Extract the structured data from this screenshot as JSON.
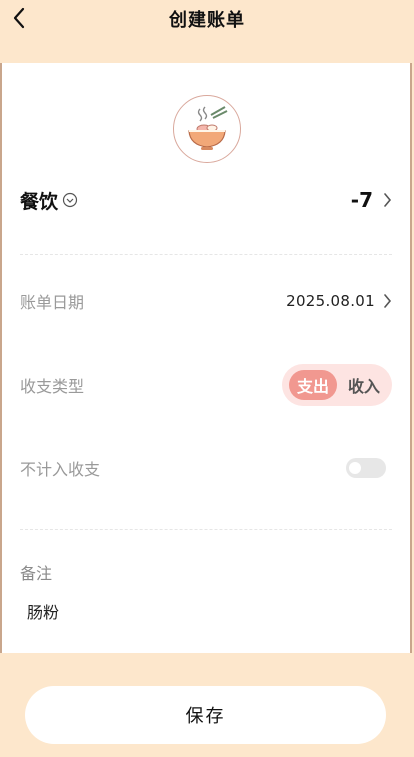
{
  "header": {
    "title": "创建账单",
    "back_icon": "chevron-left-icon"
  },
  "category": {
    "name": "餐饮",
    "icon": "noodle-bowl-icon",
    "dropdown_icon": "chevron-down-circle-icon",
    "amount": "-7"
  },
  "fields": {
    "date": {
      "label": "账单日期",
      "value": "2025.08.01"
    },
    "type": {
      "label": "收支类型",
      "options": [
        "支出",
        "收入"
      ],
      "selected": "支出"
    },
    "exclude": {
      "label": "不计入收支",
      "enabled": false
    }
  },
  "note": {
    "label": "备注",
    "value": "肠粉"
  },
  "footer": {
    "save_label": "保存"
  },
  "colors": {
    "background": "#fde7cc",
    "accent": "#f19890",
    "toggle_bg": "#fde4e2"
  }
}
